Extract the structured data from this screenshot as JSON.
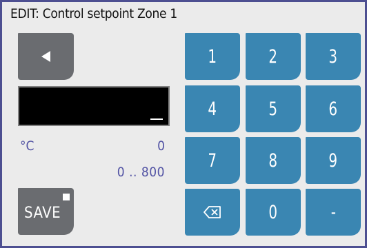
{
  "title": "EDIT: Control setpoint Zone 1",
  "value_field": {
    "value": "_"
  },
  "unit": "°C",
  "current_value": "0",
  "range": "0 .. 800",
  "buttons": {
    "save_label": "SAVE"
  },
  "keypad": {
    "k1": "1",
    "k2": "2",
    "k3": "3",
    "k4": "4",
    "k5": "5",
    "k6": "6",
    "k7": "7",
    "k8": "8",
    "k9": "9",
    "k0": "0",
    "minus": "-"
  },
  "icons": {
    "back": "triangle-left-icon",
    "backspace": "backspace-icon"
  },
  "colors": {
    "frame": "#4d4f91",
    "key_blue": "#3a86b2",
    "gray_button": "#6a6c70",
    "label_text": "#5253a4"
  }
}
